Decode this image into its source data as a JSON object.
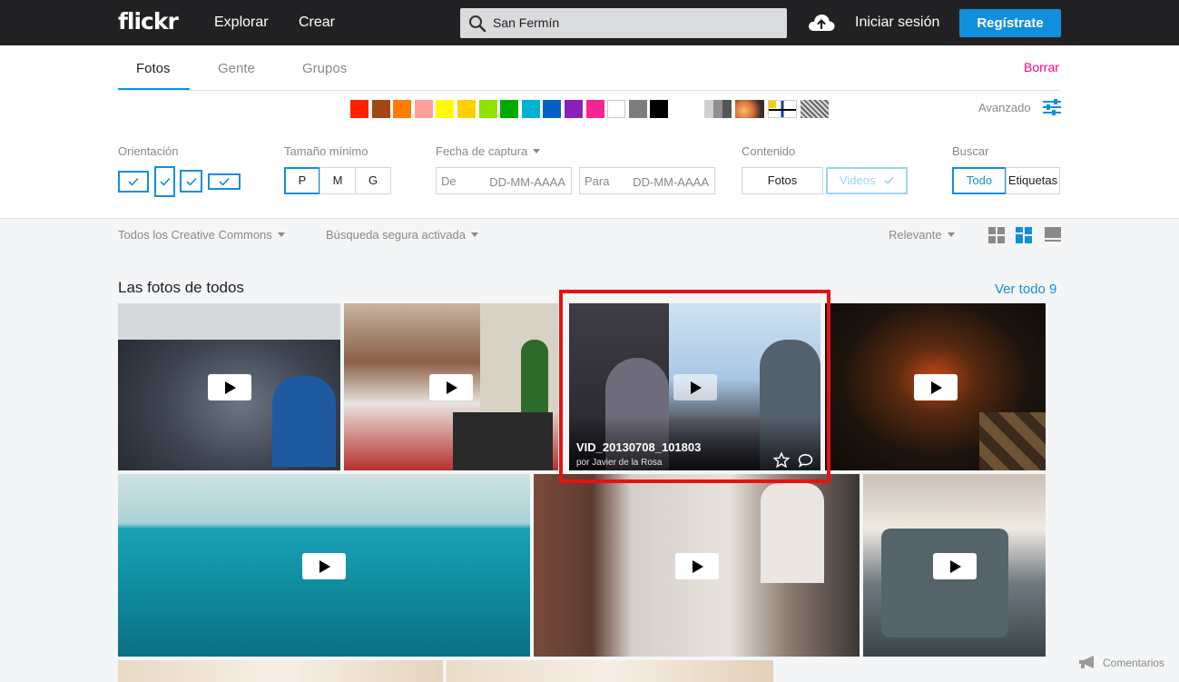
{
  "topbar": {
    "logo": "flickr",
    "nav": [
      "Explorar",
      "Crear"
    ],
    "search_value": "San Fermín",
    "login": "Iniciar sesión",
    "register": "Regístrate"
  },
  "tabs": [
    "Fotos",
    "Gente",
    "Grupos"
  ],
  "clear": "Borrar",
  "colors": [
    "#ff2000",
    "#a24615",
    "#ff7c00",
    "#ff9f9c",
    "#fffa00",
    "#ffcf00",
    "#90e200",
    "#00ab00",
    "#00b2d4",
    "#0062c6",
    "#8c20ba",
    "#f52394",
    "#ffffff",
    "#7c7c7c",
    "#000000"
  ],
  "styles": [
    "black-and-white",
    "shallow-depth-of-field",
    "minimalism",
    "patterns"
  ],
  "advanced": "Avanzado",
  "filters": {
    "orientation_label": "Orientación",
    "min_size_label": "Tamaño mínimo",
    "sizes": [
      "P",
      "M",
      "G"
    ],
    "date_label": "Fecha de captura",
    "date_from_label": "De",
    "date_to_label": "Para",
    "date_placeholder": "DD-MM-AAAA",
    "content_label": "Contenido",
    "content_photos": "Fotos",
    "content_videos": "Videos",
    "search_label": "Buscar",
    "search_all": "Todo",
    "search_tags": "Etiquetas"
  },
  "subbar": {
    "license": "Todos los Creative Commons",
    "safesearch": "Búsqueda segura activada",
    "sort": "Relevante"
  },
  "results": {
    "title": "Las fotos de todos",
    "see_all": "Ver todo 9",
    "hover_video": {
      "title": "VID_20130708_101803",
      "author": "por Javier de la Rosa"
    }
  },
  "feedback": "Comentarios"
}
